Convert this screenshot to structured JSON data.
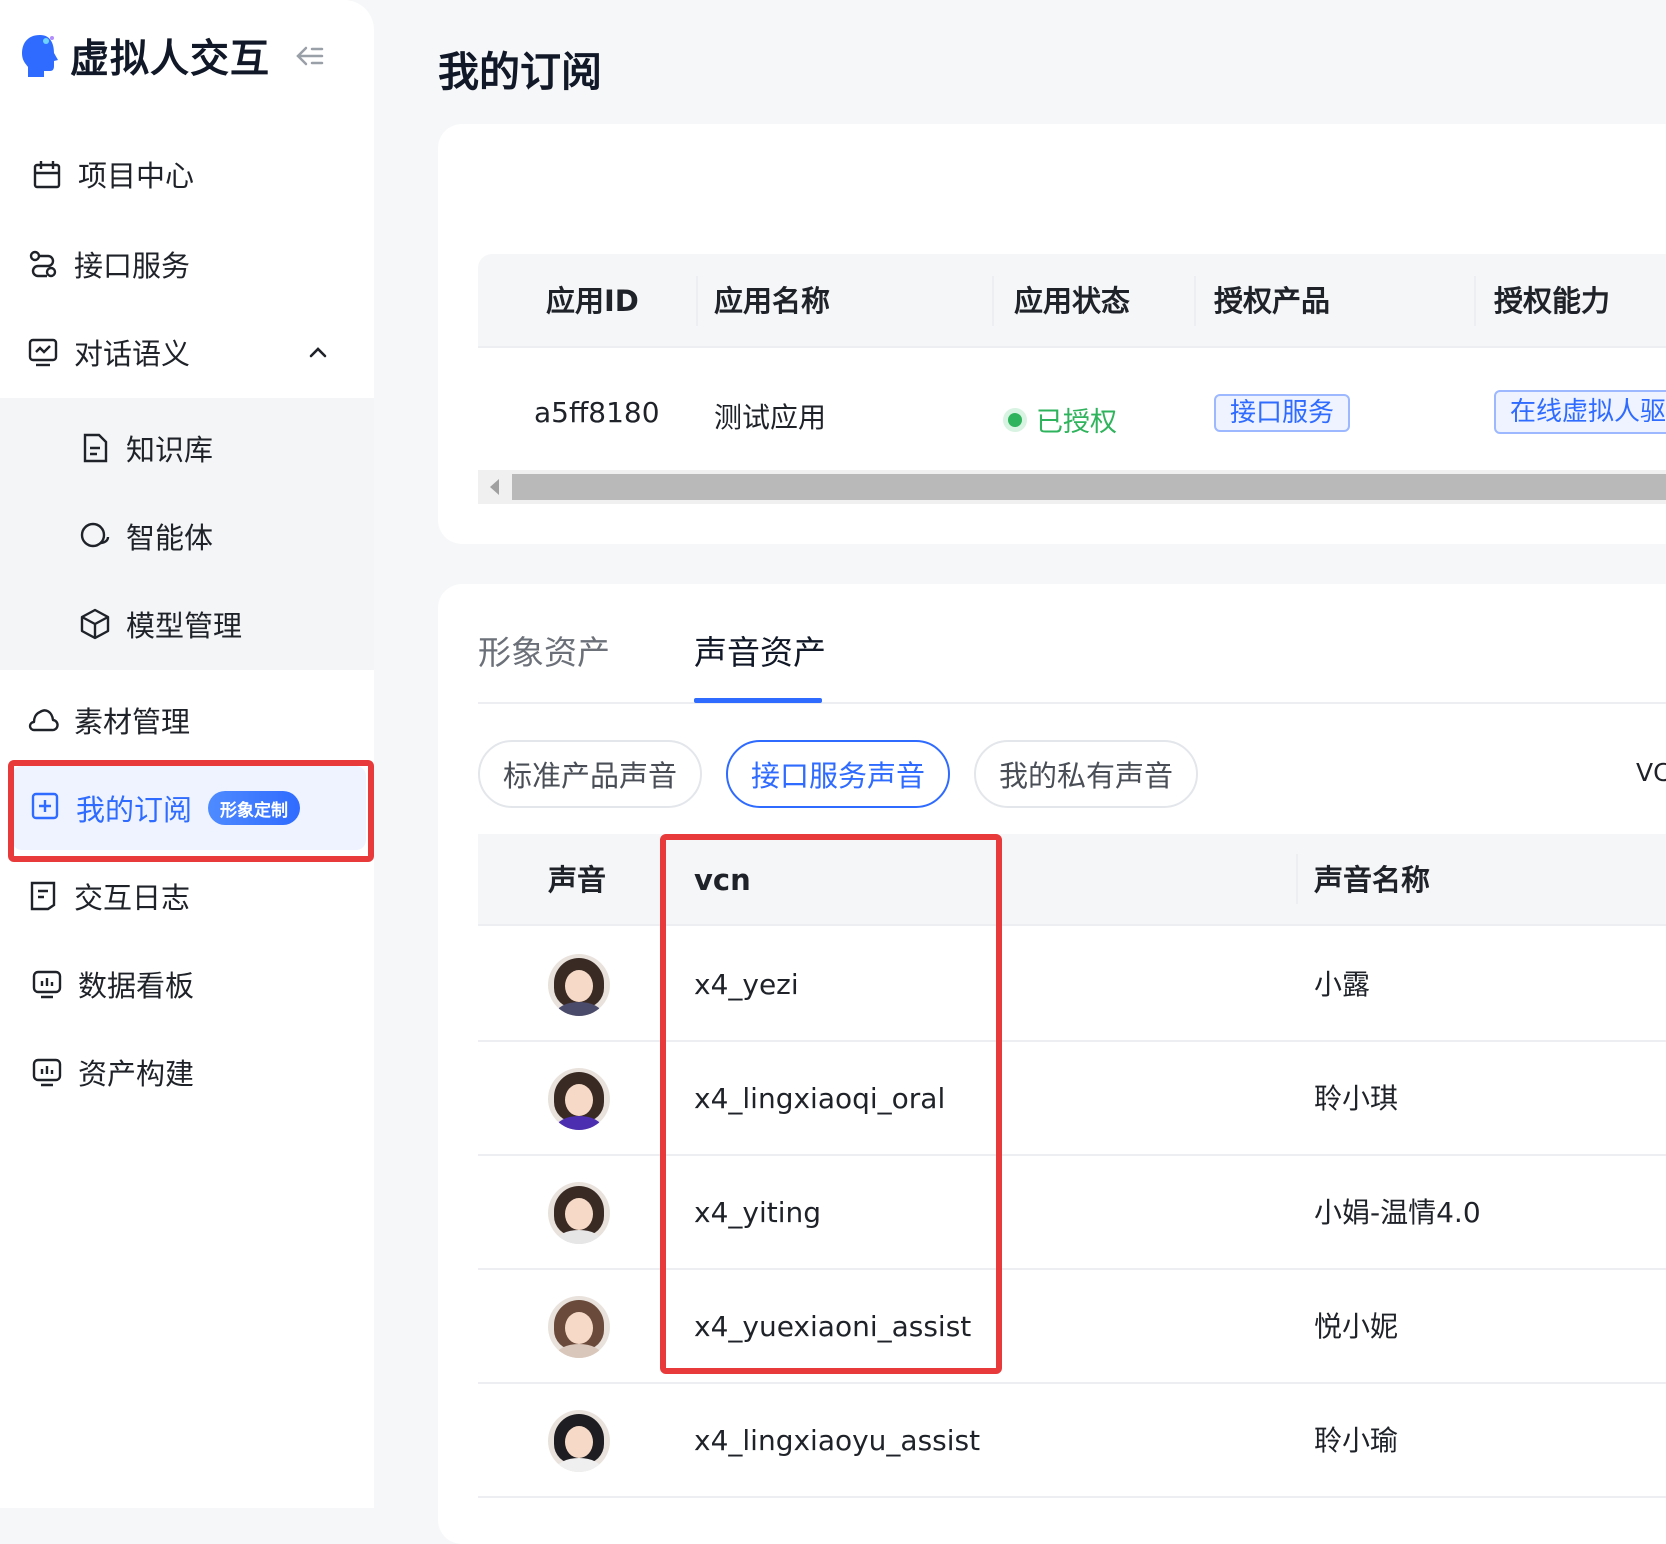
{
  "app": {
    "title": "虚拟人交互"
  },
  "sidebar": {
    "items": [
      {
        "label": "项目中心",
        "icon": "calendar-icon"
      },
      {
        "label": "接口服务",
        "icon": "route-icon"
      },
      {
        "label": "对话语义",
        "icon": "chat-monitor-icon"
      },
      {
        "label": "知识库",
        "icon": "document-icon"
      },
      {
        "label": "智能体",
        "icon": "chat-bubbles-icon"
      },
      {
        "label": "模型管理",
        "icon": "cube-icon"
      },
      {
        "label": "素材管理",
        "icon": "cloud-icon"
      },
      {
        "label": "我的订阅",
        "icon": "plus-square-icon",
        "badge": "形象定制"
      },
      {
        "label": "交互日志",
        "icon": "log-icon"
      },
      {
        "label": "数据看板",
        "icon": "chart-monitor-icon"
      },
      {
        "label": "资产构建",
        "icon": "chart-monitor-icon"
      }
    ]
  },
  "page": {
    "title": "我的订阅"
  },
  "apps_table": {
    "headers": [
      "应用ID",
      "应用名称",
      "应用状态",
      "授权产品",
      "授权能力"
    ],
    "rows": [
      {
        "id": "a5ff8180",
        "name": "测试应用",
        "status": "已授权",
        "product": "接口服务",
        "ability": "在线虚拟人驱动"
      }
    ]
  },
  "asset_tabs": [
    "形象资产",
    "声音资产"
  ],
  "active_tab": "声音资产",
  "voice_filters": [
    "标准产品声音",
    "接口服务声音",
    "我的私有声音"
  ],
  "active_filter": "接口服务声音",
  "vc_cut": "VC",
  "voice_table": {
    "headers": [
      "声音",
      "vcn",
      "声音名称"
    ],
    "rows": [
      {
        "vcn": "x4_yezi",
        "name": "小露"
      },
      {
        "vcn": "x4_lingxiaoqi_oral",
        "name": "聆小琪"
      },
      {
        "vcn": "x4_yiting",
        "name": "小娟-温情4.0"
      },
      {
        "vcn": "x4_yuexiaoni_assist",
        "name": "悦小妮"
      },
      {
        "vcn": "x4_lingxiaoyu_assist",
        "name": "聆小瑜"
      }
    ]
  },
  "colors": {
    "accent": "#2f6bff",
    "highlight": "#e83a3a",
    "success": "#2fb35c"
  }
}
